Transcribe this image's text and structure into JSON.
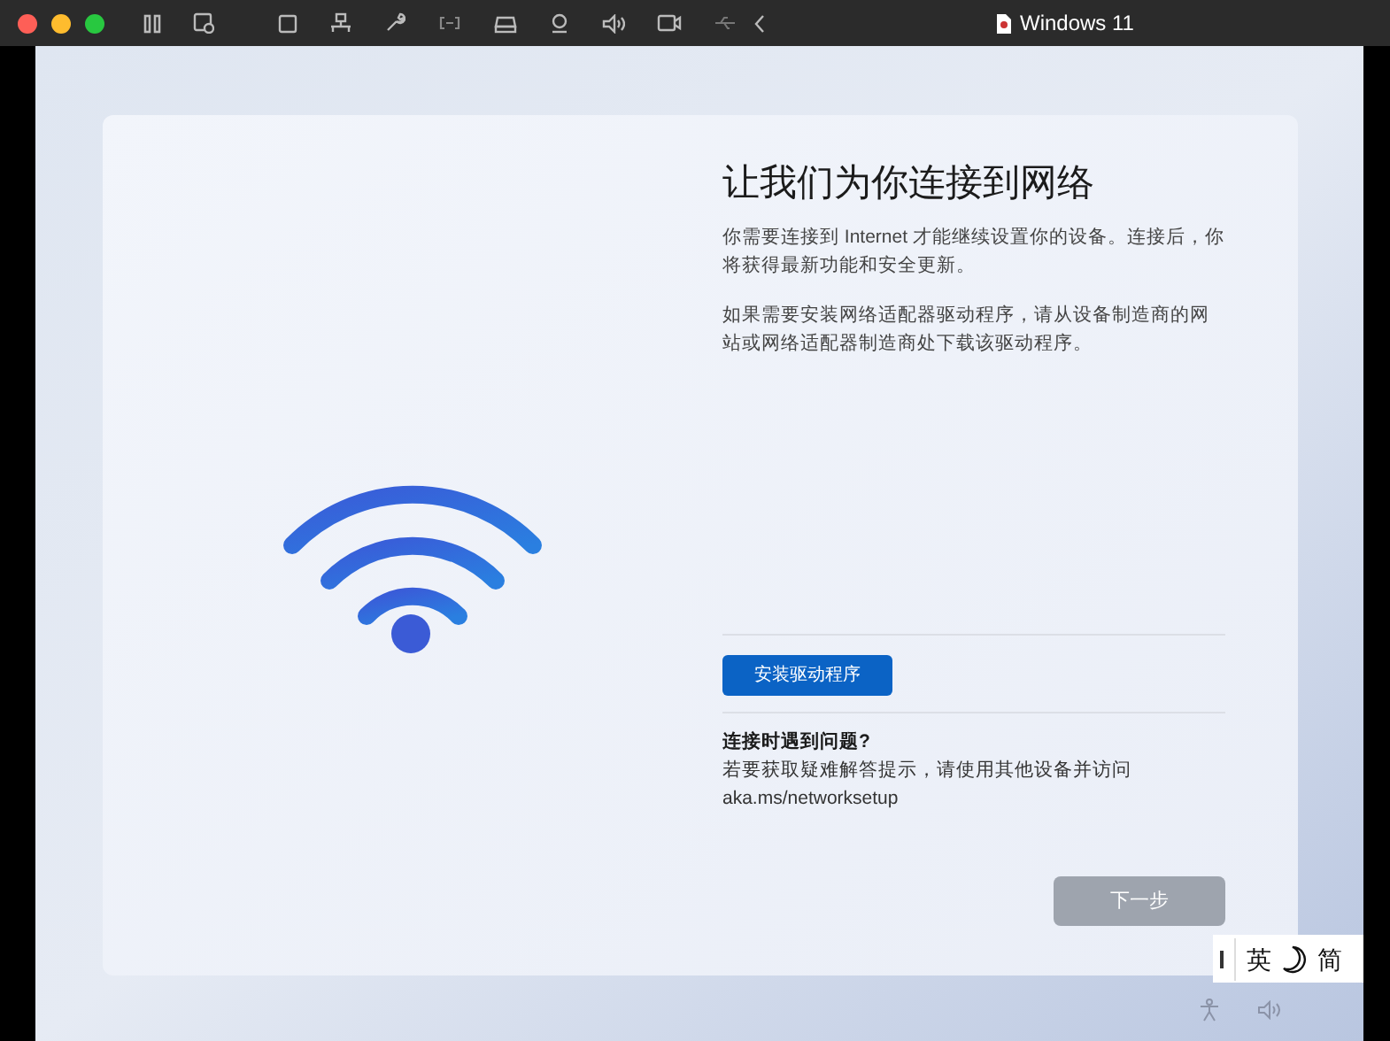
{
  "window": {
    "title": "Windows 11"
  },
  "setup": {
    "title": "让我们为你连接到网络",
    "paragraphs": [
      "你需要连接到 Internet 才能继续设置你的设备。连接后，你将获得最新功能和安全更新。",
      "如果需要安装网络适配器驱动程序，请从设备制造商的网站或网络适配器制造商处下载该驱动程序。"
    ],
    "install_button": "安装驱动程序",
    "help_heading": "连接时遇到问题?",
    "help_text": "若要获取疑难解答提示，请使用其他设备并访问 aka.ms/networksetup",
    "next_button": {
      "label": "下一步",
      "disabled": true
    }
  },
  "ime": {
    "mode": "英",
    "script": "简"
  }
}
